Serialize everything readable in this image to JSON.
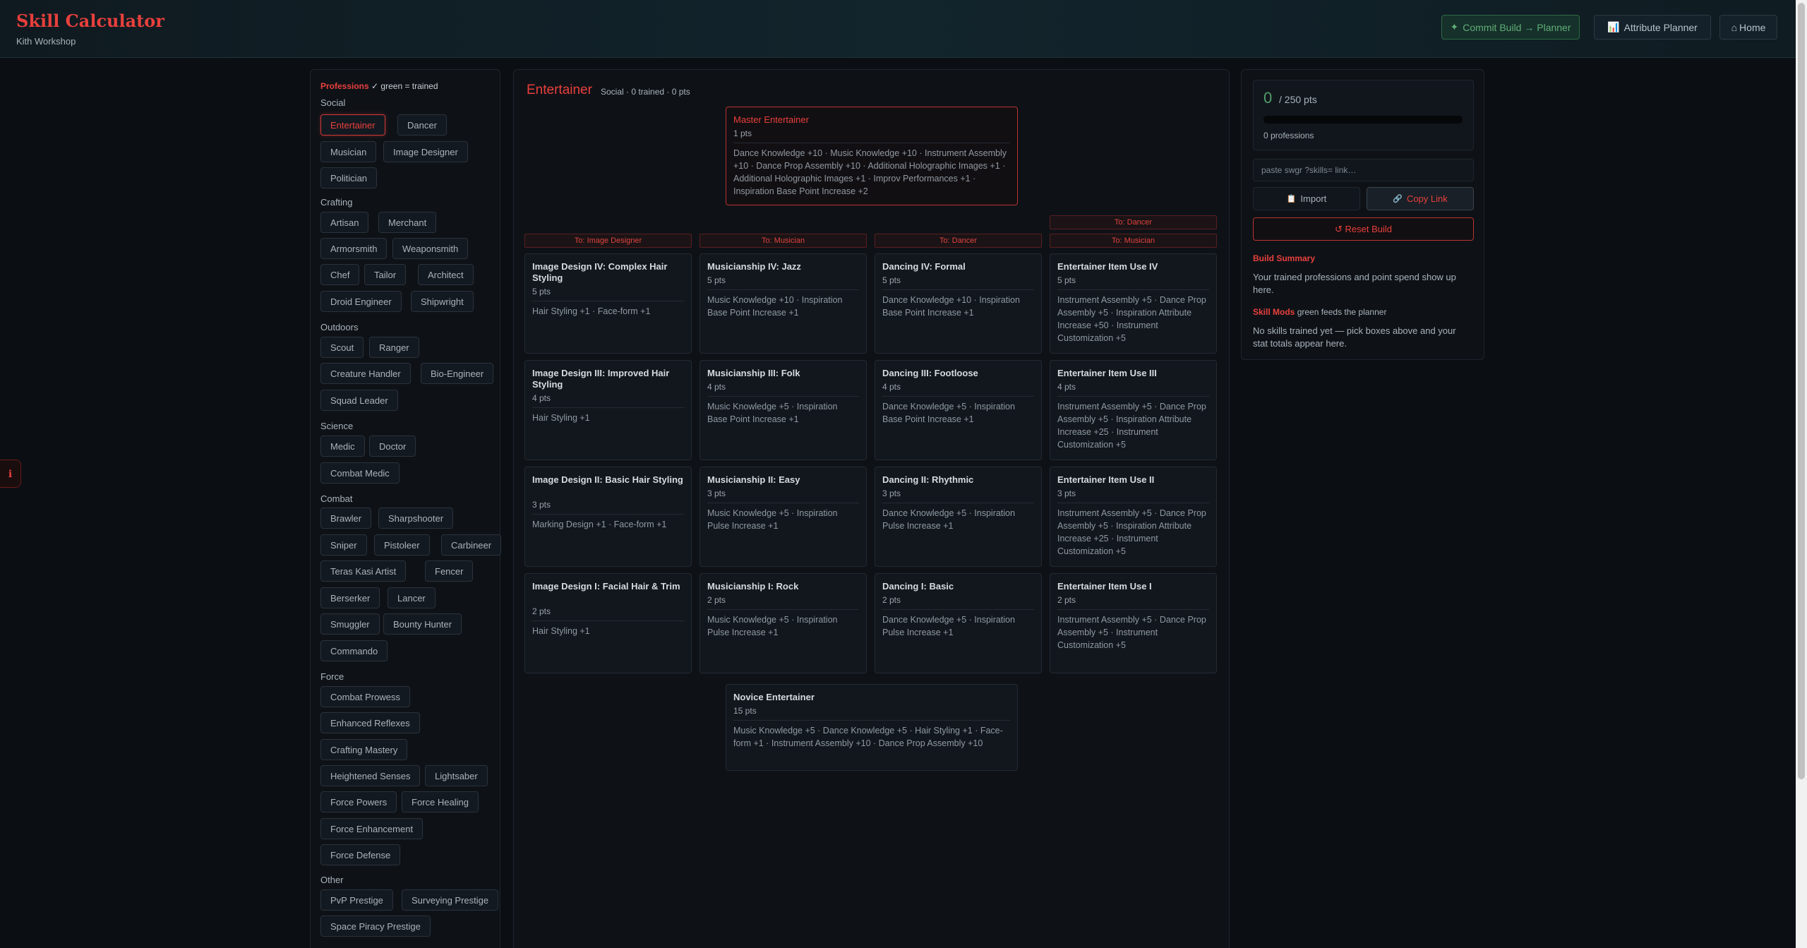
{
  "header": {
    "title": "Skill Calculator",
    "subtitle": "Kith Workshop",
    "commit_icon": "✦",
    "commit_label": "Commit Build → Planner",
    "attr_icon": "📊",
    "attr_label": "Attribute Planner",
    "home_icon": "⌂",
    "home_label": "Home"
  },
  "side_handle_icon": "ℹ",
  "professions": {
    "heading": "Professions",
    "legend": "✓ green = trained",
    "categories": [
      {
        "name": "Social",
        "items": [
          "Entertainer",
          "Dancer",
          "Musician",
          "Image Designer",
          "Politician"
        ]
      },
      {
        "name": "Crafting",
        "items": [
          "Artisan",
          "Merchant",
          "Armorsmith",
          "Weaponsmith",
          "Chef",
          "Tailor",
          "Architect",
          "Droid Engineer",
          "Shipwright"
        ]
      },
      {
        "name": "Outdoors",
        "items": [
          "Scout",
          "Ranger",
          "Creature Handler",
          "Bio-Engineer",
          "Squad Leader"
        ]
      },
      {
        "name": "Science",
        "items": [
          "Medic",
          "Doctor",
          "Combat Medic"
        ]
      },
      {
        "name": "Combat",
        "items": [
          "Brawler",
          "Sharpshooter",
          "Sniper",
          "Pistoleer",
          "Carbineer",
          "Teras Kasi Artist",
          "Fencer",
          "Berserker",
          "Lancer",
          "Smuggler",
          "Bounty Hunter",
          "Commando"
        ]
      },
      {
        "name": "Force",
        "items": [
          "Combat Prowess",
          "Enhanced Reflexes",
          "Crafting Mastery",
          "Heightened Senses",
          "Lightsaber",
          "Force Powers",
          "Force Healing",
          "Force Enhancement",
          "Force Defense"
        ]
      },
      {
        "name": "Other",
        "items": [
          "PvP Prestige",
          "Surveying Prestige",
          "Space Piracy Prestige"
        ]
      }
    ]
  },
  "tree": {
    "title": "Entertainer",
    "subtitle": "Social · 0 trained · 0 pts",
    "master": {
      "name": "Master Entertainer",
      "pts": "1 pts",
      "mods": "Dance Knowledge +10 · Music Knowledge +10 · Instrument Assembly +10 · Dance Prop Assembly +10 · Additional Holographic Images +1 · Additional Holographic Images +1 · Improv Performances +1 · Inspiration Base Point Increase +2"
    },
    "requirements": [
      "To: Image Designer",
      "To: Musician",
      "To: Dancer",
      "To: Dancer",
      "To: Musician"
    ],
    "columns": [
      [
        {
          "name": "Image Design IV: Complex Hair Styling",
          "pts": "5 pts",
          "mods": "Hair Styling +1 · Face-form +1"
        },
        {
          "name": "Image Design III: Improved Hair Styling",
          "pts": "4 pts",
          "mods": "Hair Styling +1"
        },
        {
          "name": "Image Design II: Basic Hair Styling",
          "pts": "3 pts",
          "mods": "Marking Design +1 · Face-form +1"
        },
        {
          "name": "Image Design I: Facial Hair & Trim",
          "pts": "2 pts",
          "mods": "Hair Styling +1"
        }
      ],
      [
        {
          "name": "Musicianship IV: Jazz",
          "pts": "5 pts",
          "mods": "Music Knowledge +10 · Inspiration Base Point Increase +1"
        },
        {
          "name": "Musicianship III: Folk",
          "pts": "4 pts",
          "mods": "Music Knowledge +5 · Inspiration Base Point Increase +1"
        },
        {
          "name": "Musicianship II: Easy",
          "pts": "3 pts",
          "mods": "Music Knowledge +5 · Inspiration Pulse Increase +1"
        },
        {
          "name": "Musicianship I: Rock",
          "pts": "2 pts",
          "mods": "Music Knowledge +5 · Inspiration Pulse Increase +1"
        }
      ],
      [
        {
          "name": "Dancing IV: Formal",
          "pts": "5 pts",
          "mods": "Dance Knowledge +10 · Inspiration Base Point Increase +1"
        },
        {
          "name": "Dancing III: Footloose",
          "pts": "4 pts",
          "mods": "Dance Knowledge +5 · Inspiration Base Point Increase +1"
        },
        {
          "name": "Dancing II: Rhythmic",
          "pts": "3 pts",
          "mods": "Dance Knowledge +5 · Inspiration Pulse Increase +1"
        },
        {
          "name": "Dancing I: Basic",
          "pts": "2 pts",
          "mods": "Dance Knowledge +5 · Inspiration Pulse Increase +1"
        }
      ],
      [
        {
          "name": "Entertainer Item Use IV",
          "pts": "5 pts",
          "mods": "Instrument Assembly +5 · Dance Prop Assembly +5 · Inspiration Attribute Increase +50 · Instrument Customization +5"
        },
        {
          "name": "Entertainer Item Use III",
          "pts": "4 pts",
          "mods": "Instrument Assembly +5 · Dance Prop Assembly +5 · Inspiration Attribute Increase +25 · Instrument Customization +5"
        },
        {
          "name": "Entertainer Item Use II",
          "pts": "3 pts",
          "mods": "Instrument Assembly +5 · Dance Prop Assembly +5 · Inspiration Attribute Increase +25 · Instrument Customization +5"
        },
        {
          "name": "Entertainer Item Use I",
          "pts": "2 pts",
          "mods": "Instrument Assembly +5 · Dance Prop Assembly +5 · Instrument Customization +5"
        }
      ]
    ],
    "novice": {
      "name": "Novice Entertainer",
      "pts": "15 pts",
      "mods": "Music Knowledge +5 · Dance Knowledge +5 · Hair Styling +1 · Face-form +1 · Instrument Assembly +10 · Dance Prop Assembly +10"
    }
  },
  "summary": {
    "points": "0",
    "points_of": "/ 250 pts",
    "progress_fraction": 0,
    "professions_count": "0 professions",
    "paste_placeholder": "paste swgr ?skills= link…",
    "import_icon": "📋",
    "import_label": "Import",
    "copy_icon": "🔗",
    "copy_label": "Copy Link",
    "reset_label": "↺ Reset Build",
    "build_heading": "Build Summary",
    "build_text": "Your trained professions and point spend show up here.",
    "mods_heading": "Skill Mods",
    "mods_note": "green feeds the planner",
    "mods_text": "No skills trained yet — pick boxes above and your stat totals appear here."
  }
}
